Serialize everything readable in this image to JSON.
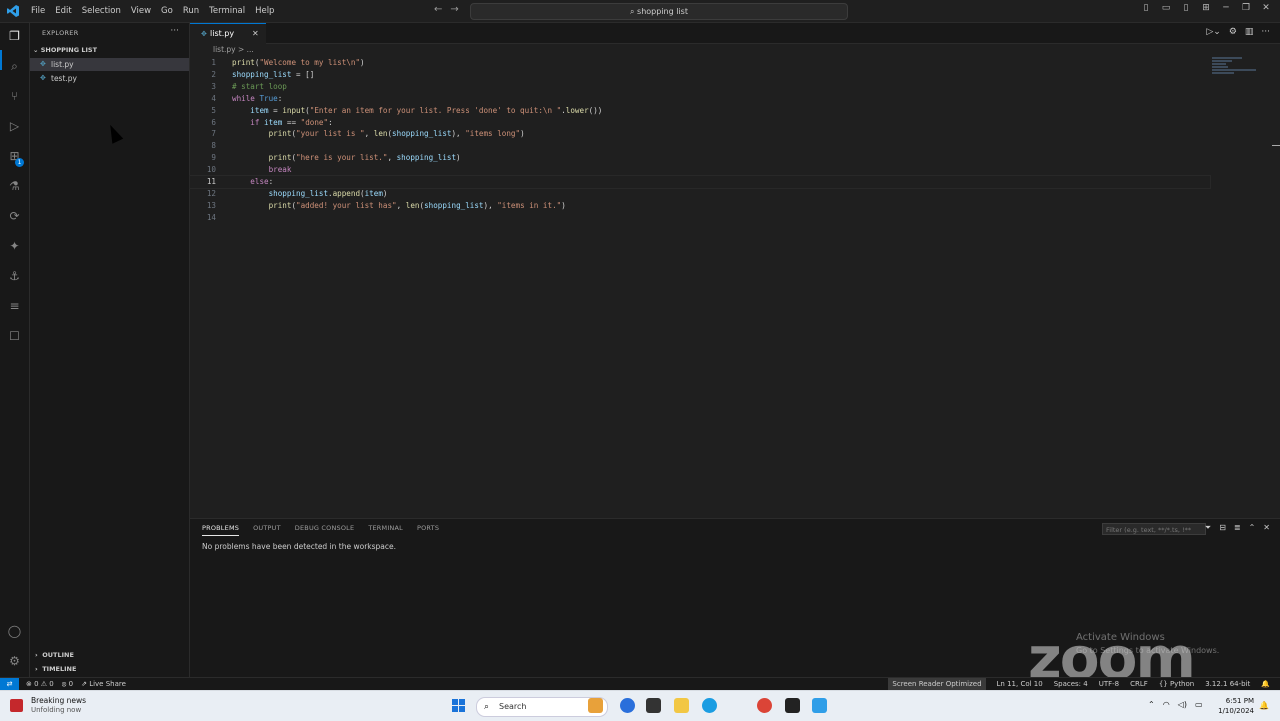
{
  "menu": [
    "File",
    "Edit",
    "Selection",
    "View",
    "Go",
    "Run",
    "Terminal",
    "Help"
  ],
  "command_center": "shopping list",
  "explorer": {
    "title": "EXPLORER",
    "folder": "SHOPPING LIST",
    "files": [
      "list.py",
      "test.py"
    ],
    "selected_file": "list.py",
    "sections": [
      "OUTLINE",
      "TIMELINE"
    ]
  },
  "editor": {
    "tab_label": "list.py",
    "breadcrumb": "list.py > ...",
    "lines": [
      {
        "n": "1",
        "segs": [
          [
            "fn",
            "print"
          ],
          [
            "",
            "("
          ],
          [
            "str",
            "\"Welcome to my list\\n\""
          ],
          [
            "",
            ")"
          ]
        ]
      },
      {
        "n": "2",
        "segs": [
          [
            "var",
            "shopping_list"
          ],
          [
            "",
            " = []"
          ]
        ]
      },
      {
        "n": "3",
        "segs": [
          [
            "cm",
            "# start loop"
          ]
        ]
      },
      {
        "n": "4",
        "segs": [
          [
            "kw",
            "while"
          ],
          [
            "",
            " "
          ],
          [
            "bi",
            "True"
          ],
          [
            "",
            ":"
          ]
        ]
      },
      {
        "n": "5",
        "segs": [
          [
            "",
            "    "
          ],
          [
            "var",
            "item"
          ],
          [
            "",
            " = "
          ],
          [
            "fn",
            "input"
          ],
          [
            "",
            "("
          ],
          [
            "str",
            "\"Enter an item for your list. Press 'done' to quit:\\n \""
          ],
          [
            "",
            "."
          ],
          [
            "fn",
            "lower"
          ],
          [
            "",
            "())"
          ]
        ]
      },
      {
        "n": "6",
        "segs": [
          [
            "",
            "    "
          ],
          [
            "kw",
            "if"
          ],
          [
            "",
            " "
          ],
          [
            "var",
            "item"
          ],
          [
            "",
            " == "
          ],
          [
            "str",
            "\"done\""
          ],
          [
            "",
            ":"
          ]
        ]
      },
      {
        "n": "7",
        "segs": [
          [
            "",
            "        "
          ],
          [
            "fn",
            "print"
          ],
          [
            "",
            "("
          ],
          [
            "str",
            "\"your list is \""
          ],
          [
            "",
            ", "
          ],
          [
            "fn",
            "len"
          ],
          [
            "",
            "("
          ],
          [
            "var",
            "shopping_list"
          ],
          [
            "",
            "), "
          ],
          [
            "str",
            "\"items long\""
          ],
          [
            "",
            ")"
          ]
        ]
      },
      {
        "n": "8",
        "segs": []
      },
      {
        "n": "9",
        "segs": [
          [
            "",
            "        "
          ],
          [
            "fn",
            "print"
          ],
          [
            "",
            "("
          ],
          [
            "str",
            "\"here is your list.\""
          ],
          [
            "",
            ", "
          ],
          [
            "var",
            "shopping_list"
          ],
          [
            "",
            ")"
          ]
        ]
      },
      {
        "n": "10",
        "segs": [
          [
            "",
            "        "
          ],
          [
            "kw",
            "break"
          ]
        ]
      },
      {
        "n": "11",
        "segs": [
          [
            "",
            "    "
          ],
          [
            "kw",
            "else"
          ],
          [
            "",
            ":"
          ]
        ]
      },
      {
        "n": "12",
        "segs": [
          [
            "",
            "        "
          ],
          [
            "var",
            "shopping_list"
          ],
          [
            "",
            "."
          ],
          [
            "fn",
            "append"
          ],
          [
            "",
            "("
          ],
          [
            "var",
            "item"
          ],
          [
            "",
            ")"
          ]
        ]
      },
      {
        "n": "13",
        "segs": [
          [
            "",
            "        "
          ],
          [
            "fn",
            "print"
          ],
          [
            "",
            "("
          ],
          [
            "str",
            "\"added! your list has\""
          ],
          [
            "",
            ", "
          ],
          [
            "fn",
            "len"
          ],
          [
            "",
            "("
          ],
          [
            "var",
            "shopping_list"
          ],
          [
            "",
            "), "
          ],
          [
            "str",
            "\"items in it.\""
          ],
          [
            "",
            ")"
          ]
        ]
      },
      {
        "n": "14",
        "segs": []
      }
    ],
    "current_line": "11"
  },
  "panel": {
    "tabs": [
      "PROBLEMS",
      "OUTPUT",
      "DEBUG CONSOLE",
      "TERMINAL",
      "PORTS"
    ],
    "active_tab": "PROBLEMS",
    "filter_placeholder": "Filter (e.g. text, **/*.ts, !**",
    "message": "No problems have been detected in the workspace."
  },
  "watermark": {
    "activate_title": "Activate Windows",
    "activate_sub": "Go to Settings to activate Windows.",
    "zoom": "zoom"
  },
  "statusbar": {
    "errors": "0",
    "warnings": "0",
    "ports": "0",
    "live_share": "Live Share",
    "screen_reader": "Screen Reader Optimized",
    "position": "Ln 11, Col 10",
    "spaces": "Spaces: 4",
    "encoding": "UTF-8",
    "eol": "CRLF",
    "language": "Python",
    "interpreter": "3.12.1 64-bit"
  },
  "taskbar": {
    "news_title": "Breaking news",
    "news_sub": "Unfolding now",
    "search_label": "Search",
    "time": "6:51 PM",
    "date": "1/10/2024"
  }
}
